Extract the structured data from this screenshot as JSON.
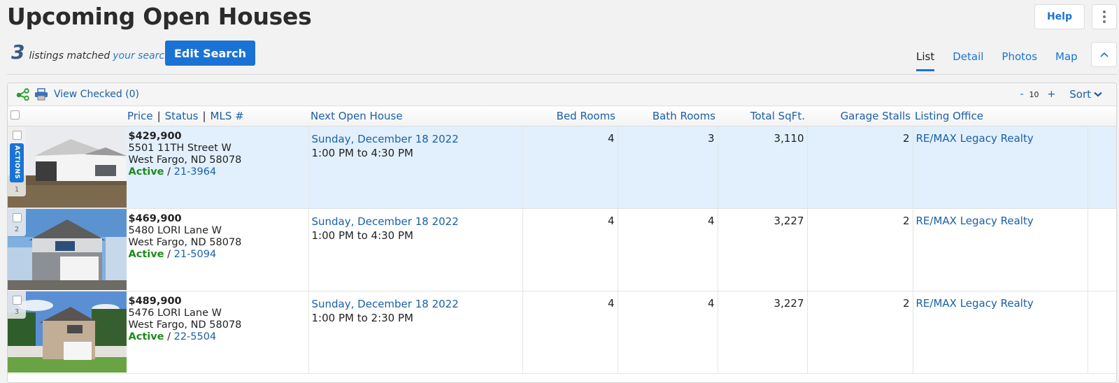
{
  "page": {
    "title": "Upcoming Open Houses",
    "match_count": "3",
    "match_text": "listings matched",
    "match_link": "your search",
    "edit_search_label": "Edit Search",
    "help_label": "Help",
    "more_icon": "kebab-vertical-icon",
    "collapse_icon": "chevron-up-icon"
  },
  "view_tabs": [
    {
      "label": "List",
      "active": true
    },
    {
      "label": "Detail",
      "active": false
    },
    {
      "label": "Photos",
      "active": false
    },
    {
      "label": "Map",
      "active": false
    }
  ],
  "toolbar": {
    "share_icon": "share-icon",
    "print_icon": "print-icon",
    "view_checked_label": "View Checked (0)",
    "page_minus": "-",
    "page_size": "10",
    "page_plus": "+",
    "sort_label": "Sort",
    "sort_icon": "chevron-down-icon"
  },
  "table": {
    "headers": {
      "price": "Price",
      "status": "Status",
      "mls": "MLS #",
      "separator": "|",
      "next_open_house": "Next Open House",
      "bed_rooms": "Bed Rooms",
      "bath_rooms": "Bath Rooms",
      "total_sqft": "Total SqFt.",
      "garage_stalls": "Garage Stalls",
      "listing_office": "Listing Office"
    },
    "actions_label": "ACTIONS",
    "rows": [
      {
        "num": "1",
        "selected": true,
        "price": "$429,900",
        "street": "5501 11TH Street W",
        "city": "West Fargo, ND 58078",
        "status": "Active",
        "slash": "/",
        "mls": "21-3964",
        "oh_date": "Sunday, December 18 2022",
        "oh_time": "1:00 PM to 4:30 PM",
        "beds": "4",
        "baths": "3",
        "sqft": "3,110",
        "garage": "2",
        "office": "RE/MAX Legacy Realty"
      },
      {
        "num": "2",
        "selected": false,
        "price": "$469,900",
        "street": "5480 LORI Lane W",
        "city": "West Fargo, ND 58078",
        "status": "Active",
        "slash": "/",
        "mls": "21-5094",
        "oh_date": "Sunday, December 18 2022",
        "oh_time": "1:00 PM to 4:30 PM",
        "beds": "4",
        "baths": "4",
        "sqft": "3,227",
        "garage": "2",
        "office": "RE/MAX Legacy Realty"
      },
      {
        "num": "3",
        "selected": false,
        "price": "$489,900",
        "street": "5476 LORI Lane W",
        "city": "West Fargo, ND 58078",
        "status": "Active",
        "slash": "/",
        "mls": "22-5504",
        "oh_date": "Sunday, December 18 2022",
        "oh_time": "1:00 PM to 2:30 PM",
        "beds": "4",
        "baths": "4",
        "sqft": "3,227",
        "garage": "2",
        "office": "RE/MAX Legacy Realty"
      }
    ]
  },
  "colors": {
    "accent": "#1a73d4",
    "link": "#1a5fa8",
    "status_active": "#1d8a1d",
    "selected_row": "#e2f0fd"
  }
}
